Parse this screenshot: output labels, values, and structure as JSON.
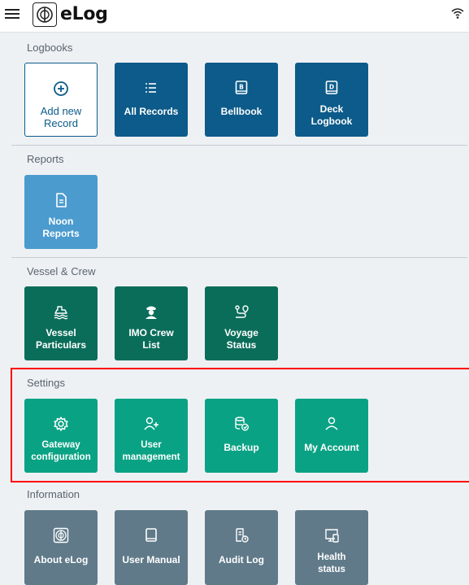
{
  "app": {
    "title": "eLog"
  },
  "sections": {
    "logbooks": {
      "title": "Logbooks",
      "tiles": [
        {
          "label": "Add new\nRecord",
          "icon": "plus-circle-icon"
        },
        {
          "label": "All Records",
          "icon": "list-icon"
        },
        {
          "label": "Bellbook",
          "icon": "book-b-icon"
        },
        {
          "label": "Deck\nLogbook",
          "icon": "book-d-icon"
        }
      ]
    },
    "reports": {
      "title": "Reports",
      "tiles": [
        {
          "label": "Noon\nReports",
          "icon": "document-icon"
        }
      ]
    },
    "vessel_crew": {
      "title": "Vessel & Crew",
      "tiles": [
        {
          "label": "Vessel\nParticulars",
          "icon": "ship-icon"
        },
        {
          "label": "IMO Crew\nList",
          "icon": "captain-icon"
        },
        {
          "label": "Voyage\nStatus",
          "icon": "route-icon"
        }
      ]
    },
    "settings": {
      "title": "Settings",
      "tiles": [
        {
          "label": "Gateway\nconfiguration",
          "icon": "gear-icon"
        },
        {
          "label": "User\nmanagement",
          "icon": "user-add-icon"
        },
        {
          "label": "Backup",
          "icon": "database-backup-icon"
        },
        {
          "label": "My Account",
          "icon": "user-icon"
        }
      ]
    },
    "information": {
      "title": "Information",
      "tiles": [
        {
          "label": "About eLog",
          "icon": "elog-logo-icon"
        },
        {
          "label": "User Manual",
          "icon": "book-icon"
        },
        {
          "label": "Audit Log",
          "icon": "audit-log-icon"
        },
        {
          "label": "Health\nstatus",
          "icon": "devices-icon"
        }
      ]
    }
  },
  "colors": {
    "logbook_blue": "#0c5b8a",
    "reports_blue": "#4b9bcf",
    "vessel_green": "#0a6d5a",
    "settings_teal": "#0aa284",
    "information_gray": "#607a89",
    "highlight_red": "#ff0000"
  }
}
